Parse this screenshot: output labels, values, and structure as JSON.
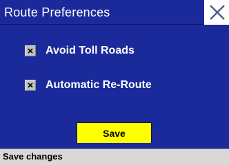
{
  "window": {
    "title": "Route Preferences",
    "close_icon": "close-icon"
  },
  "options": [
    {
      "label": "Avoid Toll Roads",
      "checked": true
    },
    {
      "label": "Automatic Re-Route",
      "checked": true
    }
  ],
  "actions": {
    "save_label": "Save"
  },
  "status": {
    "text": "Save changes"
  },
  "colors": {
    "panel": "#1b2a9a",
    "accent_button": "#ffff00",
    "statusbar": "#d8d8d8",
    "text_on_panel": "#ffffff"
  }
}
